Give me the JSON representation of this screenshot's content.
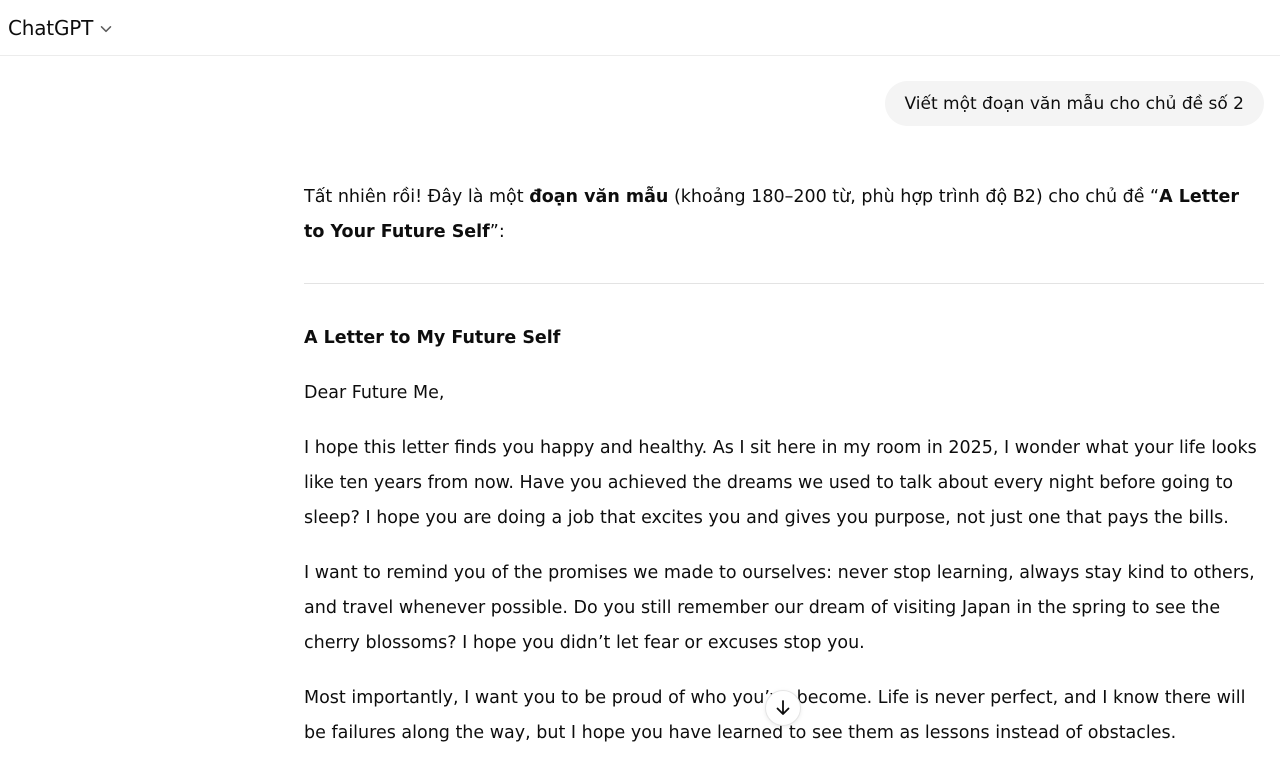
{
  "header": {
    "model_name": "ChatGPT",
    "chevron_icon": "chevron-down-icon"
  },
  "user_message": {
    "text": "Viết một đoạn văn mẫu cho chủ đề số 2"
  },
  "assistant_message": {
    "intro": {
      "part1": "Tất nhiên rồi! Đây là một ",
      "bold1": "đoạn văn mẫu",
      "part2": " (khoảng 180–200 từ, phù hợp trình độ B2) cho chủ đề “",
      "bold2": "A Letter to Your Future Self",
      "part3": "”:"
    },
    "letter_title": "A Letter to My Future Self",
    "greeting": "Dear Future Me,",
    "paragraphs": [
      "I hope this letter finds you happy and healthy. As I sit here in my room in 2025, I wonder what your life looks like ten years from now. Have you achieved the dreams we used to talk about every night before going to sleep? I hope you are doing a job that excites you and gives you purpose, not just one that pays the bills.",
      "I want to remind you of the promises we made to ourselves: never stop learning, always stay kind to others, and travel whenever possible. Do you still remember our dream of visiting Japan in the spring to see the cherry blossoms? I hope you didn’t let fear or excuses stop you.",
      "Most importantly, I want you to be proud of who you’ve become. Life is never perfect, and I know there will be failures along the way, but I hope you have learned to see them as lessons instead of obstacles."
    ]
  },
  "scroll_button": {
    "icon": "arrow-down-icon"
  }
}
